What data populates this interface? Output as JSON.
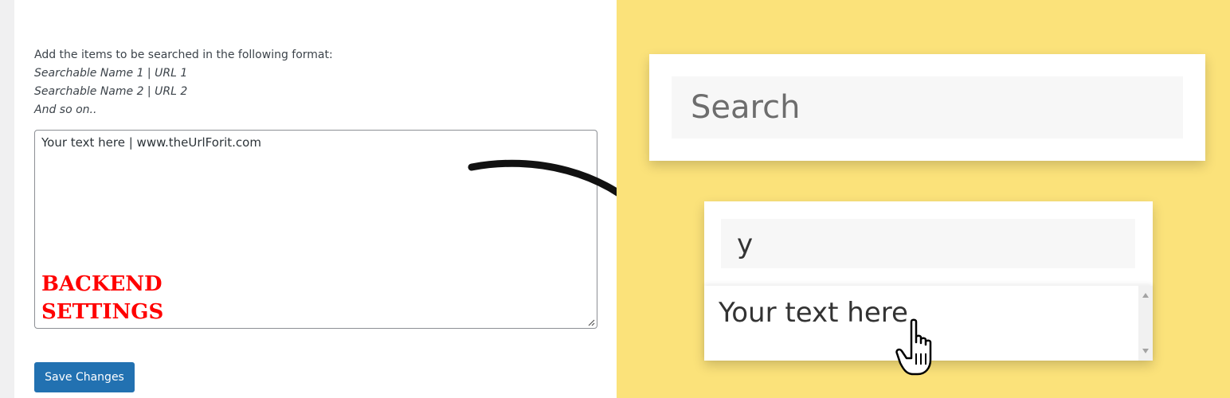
{
  "admin": {
    "instructions": {
      "line1": "Add the items to be searched in the following format:",
      "line2": "Searchable Name 1 | URL 1",
      "line3": "Searchable Name 2 | URL 2",
      "line4": "And so on.."
    },
    "textarea_value": "Your text here | www.theUrlForit.com",
    "overlay_label_line1": "BACKEND",
    "overlay_label_line2": "SETTINGS",
    "save_button_label": "Save Changes"
  },
  "frontend": {
    "search_placeholder": "Search",
    "search_query": "y",
    "suggestion_item": "Your text here"
  },
  "colors": {
    "background_yellow": "#fbe27a",
    "primary_button": "#2271b1",
    "label_red": "#ff0000"
  },
  "icons": [
    "curved-arrow-icon",
    "hand-pointer-icon",
    "resize-grip-icon",
    "scroll-up-icon",
    "scroll-down-icon"
  ]
}
